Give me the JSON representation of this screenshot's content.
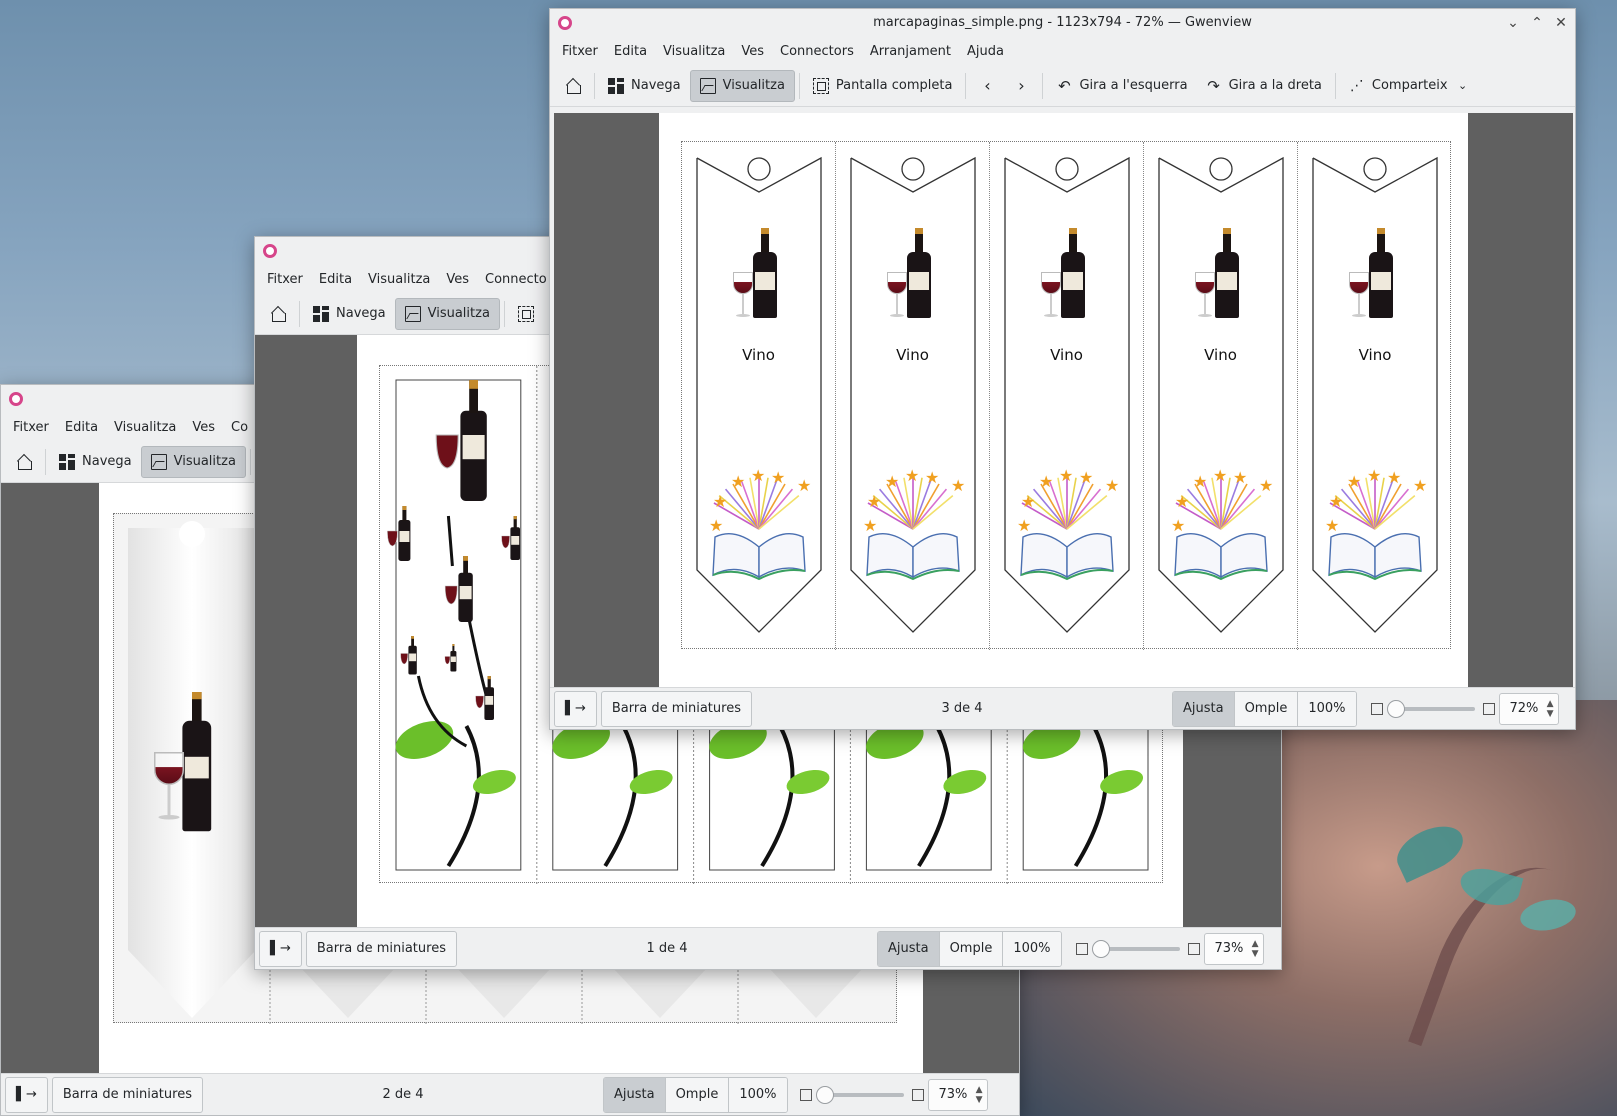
{
  "app_name": "Gwenview",
  "menus": [
    "Fitxer",
    "Edita",
    "Visualitza",
    "Ves",
    "Connectors",
    "Arranjament",
    "Ajuda"
  ],
  "menus_truncated_mid": [
    "Fitxer",
    "Edita",
    "Visualitza",
    "Ves",
    "Connecto"
  ],
  "menus_truncated_back": [
    "Fitxer",
    "Edita",
    "Visualitza",
    "Ves",
    "Co"
  ],
  "toolbar": {
    "navigate": "Navega",
    "view": "Visualitza",
    "fullscreen": "Pantalla completa",
    "rotate_left": "Gira a l'esquerra",
    "rotate_right": "Gira a la dreta",
    "share": "Comparteix"
  },
  "icons": {
    "home": "home-icon",
    "navigate": "grid-icon",
    "view": "image-icon",
    "fullscreen": "fullscreen-icon",
    "prev": "chevron-left-icon",
    "next": "chevron-right-icon",
    "rotate_left": "rotate-left-icon",
    "rotate_right": "rotate-right-icon",
    "share": "share-icon",
    "share_menu": "chevron-down-icon",
    "minimize": "chevron-down-icon",
    "maximize": "chevron-up-icon",
    "close": "close-icon",
    "sidebar_toggle": "sidebar-toggle-icon"
  },
  "statusbar": {
    "thumbnail_bar": "Barra de miniatures",
    "fit": "Ajusta",
    "fill": "Omple",
    "actual": "100%",
    "sidebar_toggle_glyph": "▌→"
  },
  "windows": {
    "front": {
      "title": "marcapaginas_simple.png - 1123x794 - 72% — Gwenview",
      "counter": "3 de 4",
      "zoom": "72%"
    },
    "middle": {
      "counter": "1 de 4",
      "zoom": "73%"
    },
    "back": {
      "counter": "2 de 4",
      "zoom": "73%"
    }
  },
  "bookmarks": {
    "label": "Vino",
    "count": 5
  },
  "colors": {
    "accent_icon": "#d6458a",
    "window_bg": "#eff0f1",
    "viewport_bg": "#606060",
    "active_button": "#c9cdd1"
  }
}
